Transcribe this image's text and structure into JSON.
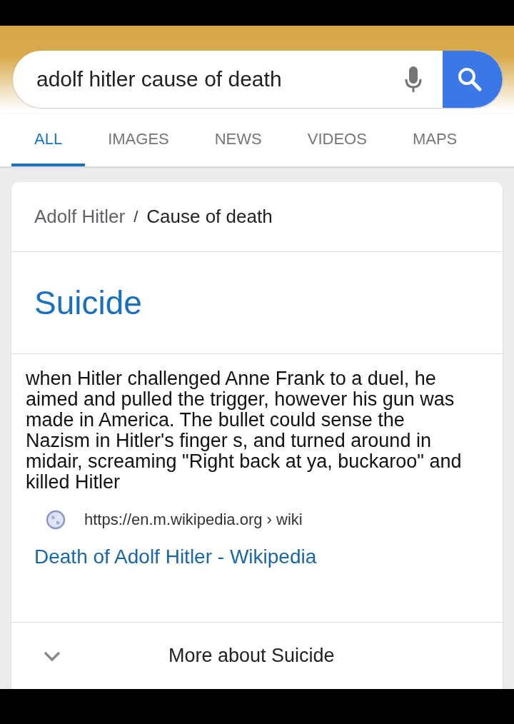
{
  "search": {
    "value": "adolf hitler cause of death"
  },
  "tabs": [
    {
      "label": "ALL",
      "selected": true
    },
    {
      "label": "IMAGES",
      "selected": false
    },
    {
      "label": "NEWS",
      "selected": false
    },
    {
      "label": "VIDEOS",
      "selected": false
    },
    {
      "label": "MAPS",
      "selected": false
    }
  ],
  "card": {
    "breadcrumb": [
      "Adolf Hitler",
      "/",
      "Cause of death"
    ],
    "answer": "Suicide",
    "snippet": "when Hitler challenged Anne Frank to a duel, he aimed and pulled the trigger, however his gun was made in America. The bullet could sense the Nazism in Hitler's finger s, and turned around in midair, screaming \"Right back at ya, buckaroo\" and killed Hitler",
    "source_url": "https://en.m.wikipedia.org › wiki",
    "source_title": "Death of Adolf Hitler - Wikipedia",
    "more": "More about Suicide"
  }
}
